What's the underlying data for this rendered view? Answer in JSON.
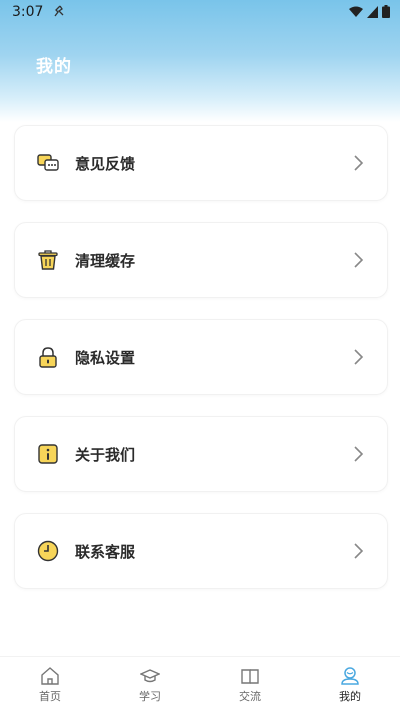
{
  "status": {
    "time": "3:07"
  },
  "header": {
    "title": "我的"
  },
  "menu": [
    {
      "label": "意见反馈",
      "icon": "feedback-chat-icon"
    },
    {
      "label": "清理缓存",
      "icon": "trash-icon"
    },
    {
      "label": "隐私设置",
      "icon": "lock-icon"
    },
    {
      "label": "关于我们",
      "icon": "info-icon"
    },
    {
      "label": "联系客服",
      "icon": "clock-icon"
    }
  ],
  "tabs": [
    {
      "label": "首页",
      "icon": "home-icon",
      "active": false
    },
    {
      "label": "学习",
      "icon": "graduation-cap-icon",
      "active": false
    },
    {
      "label": "交流",
      "icon": "book-icon",
      "active": false
    },
    {
      "label": "我的",
      "icon": "user-icon",
      "active": true
    }
  ],
  "colors": {
    "header_top": "#79c4ea",
    "icon_yellow": "#f7d559",
    "icon_outline": "#333333",
    "active_tab": "#4aa8e0"
  }
}
